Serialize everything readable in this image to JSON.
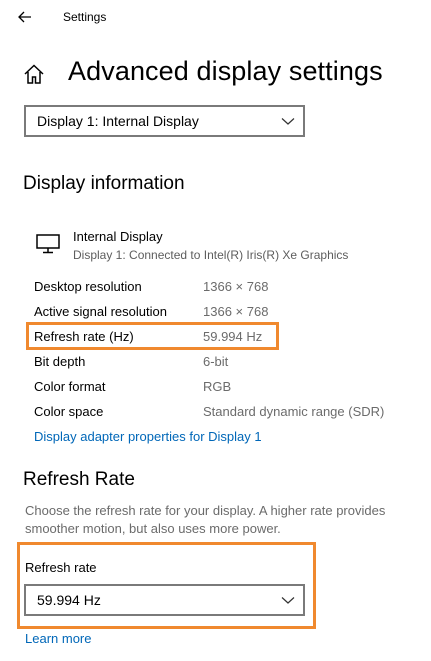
{
  "window": {
    "title": "Settings"
  },
  "header": {
    "title": "Advanced display settings"
  },
  "display_select": {
    "value": "Display 1: Internal Display"
  },
  "display_information": {
    "heading": "Display information",
    "monitor": {
      "name": "Internal Display",
      "subtitle": "Display 1: Connected to Intel(R) Iris(R) Xe Graphics"
    },
    "rows": [
      {
        "label": "Desktop resolution",
        "value": "1366 × 768"
      },
      {
        "label": "Active signal resolution",
        "value": "1366 × 768"
      },
      {
        "label": "Refresh rate (Hz)",
        "value": "59.994 Hz"
      },
      {
        "label": "Bit depth",
        "value": "6-bit"
      },
      {
        "label": "Color format",
        "value": "RGB"
      },
      {
        "label": "Color space",
        "value": "Standard dynamic range (SDR)"
      }
    ],
    "adapter_link": "Display adapter properties for Display 1"
  },
  "refresh_rate": {
    "heading": "Refresh Rate",
    "description": "Choose the refresh rate for your display. A higher rate provides smoother motion, but also uses more power.",
    "field_label": "Refresh rate",
    "selected_value": "59.994 Hz",
    "learn_more": "Learn more"
  },
  "icons": {
    "back": "arrow-left-icon",
    "home": "home-icon",
    "monitor": "monitor-icon",
    "chevron": "chevron-down-icon"
  },
  "colors": {
    "link": "#0067b8",
    "highlight": "#f0892e",
    "secondary_text": "#6b6b6b"
  }
}
